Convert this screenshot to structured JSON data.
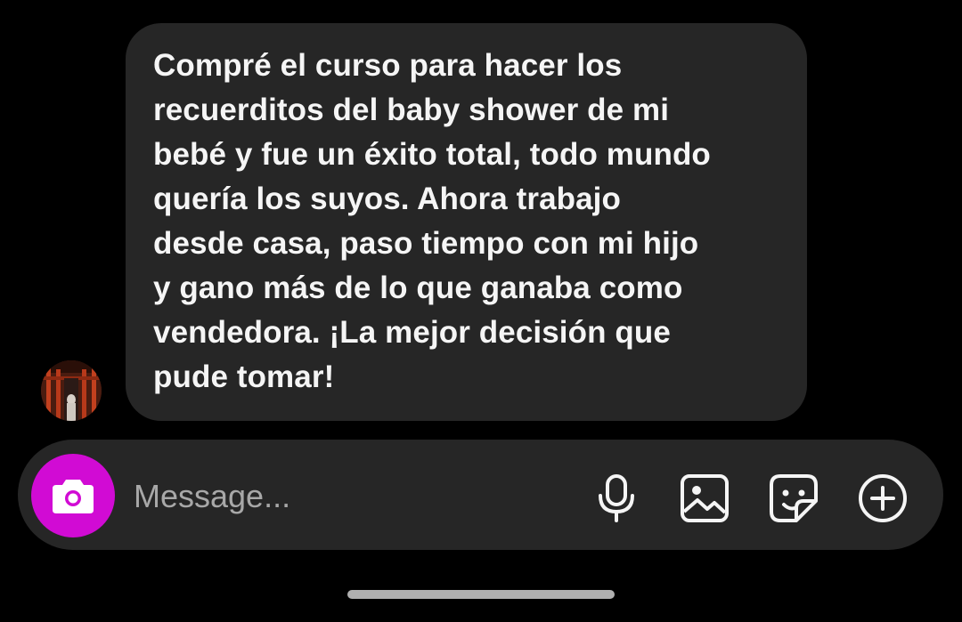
{
  "conversation": {
    "messages": [
      {
        "sender": "other",
        "text": "Compré el curso para hacer los\nrecuerditos del baby shower de mi\nbebé y fue un éxito total, todo mundo\nquería los suyos. Ahora trabajo\ndesde casa, paso tiempo con mi hijo\ny gano más de lo que ganaba como\nvendedora. ¡La mejor decisión que\npude tomar!"
      }
    ]
  },
  "composer": {
    "placeholder": "Message...",
    "value": "",
    "camera_icon": "camera-icon",
    "tools": [
      "microphone-icon",
      "gallery-icon",
      "sticker-icon",
      "plus-circle-icon"
    ]
  },
  "colors": {
    "background": "#000000",
    "bubble": "#262626",
    "accent": "#d10bd4",
    "text": "#f5f5f5",
    "placeholder": "#a8a8a8"
  }
}
